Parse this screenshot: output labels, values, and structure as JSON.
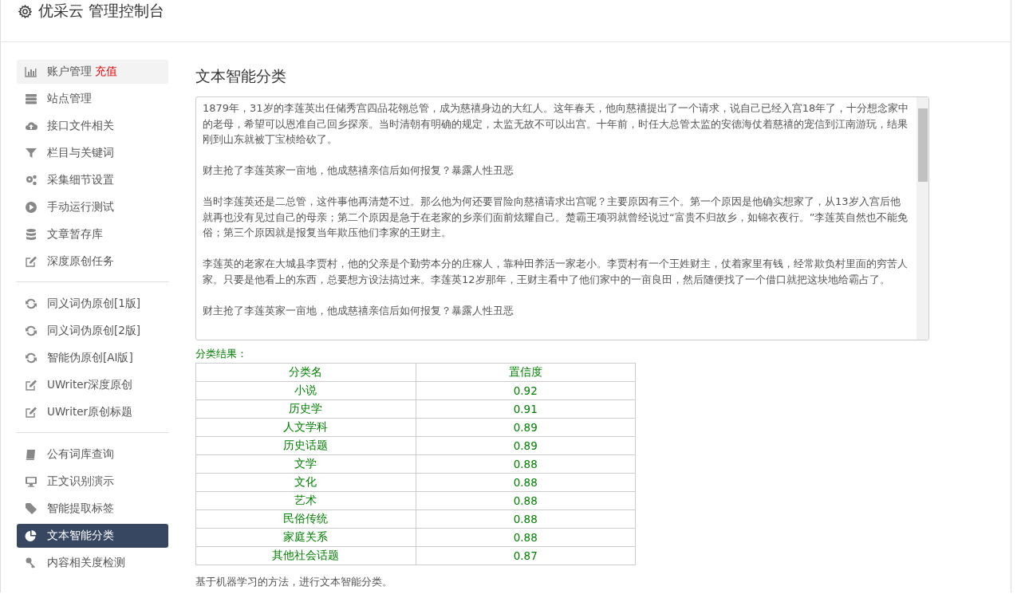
{
  "header": {
    "title": "优采云 管理控制台"
  },
  "sidebar": {
    "groups": [
      {
        "items": [
          {
            "kind": "chart",
            "label": "账户管理",
            "badge": "充值",
            "highlighted": true,
            "selected": false
          },
          {
            "kind": "server",
            "label": "站点管理",
            "highlighted": false,
            "selected": false
          },
          {
            "kind": "cloud",
            "label": "接口文件相关",
            "highlighted": false,
            "selected": false
          },
          {
            "kind": "filter",
            "label": "栏目与关键词",
            "highlighted": false,
            "selected": false
          },
          {
            "kind": "gears",
            "label": "采集细节设置",
            "highlighted": false,
            "selected": false
          },
          {
            "kind": "play",
            "label": "手动运行测试",
            "highlighted": false,
            "selected": false
          },
          {
            "kind": "database",
            "label": "文章暂存库",
            "highlighted": false,
            "selected": false
          },
          {
            "kind": "edit",
            "label": "深度原创任务",
            "highlighted": false,
            "selected": false
          }
        ]
      },
      {
        "items": [
          {
            "kind": "refresh",
            "label": "同义词伪原创[1版]",
            "highlighted": false,
            "selected": false
          },
          {
            "kind": "refresh",
            "label": "同义词伪原创[2版]",
            "highlighted": false,
            "selected": false
          },
          {
            "kind": "refresh",
            "label": "智能伪原创[AI版]",
            "highlighted": false,
            "selected": false
          },
          {
            "kind": "edit",
            "label": "UWriter深度原创",
            "highlighted": false,
            "selected": false
          },
          {
            "kind": "edit",
            "label": "UWriter原创标题",
            "highlighted": false,
            "selected": false
          }
        ]
      },
      {
        "items": [
          {
            "kind": "book",
            "label": "公有词库查询",
            "highlighted": false,
            "selected": false
          },
          {
            "kind": "monitor",
            "label": "正文识别演示",
            "highlighted": false,
            "selected": false
          },
          {
            "kind": "tag",
            "label": "智能提取标签",
            "highlighted": false,
            "selected": false
          },
          {
            "kind": "pie",
            "label": "文本智能分类",
            "highlighted": false,
            "selected": true
          },
          {
            "kind": "key",
            "label": "内容相关度检测",
            "highlighted": false,
            "selected": false
          }
        ]
      }
    ]
  },
  "main": {
    "title": "文本智能分类",
    "input_text": [
      "1879年，31岁的李莲英出任储秀宫四品花翎总管，成为慈禧身边的大红人。这年春天，他向慈禧提出了一个请求，说自己已经入宫18年了，十分想念家中的老母，希望可以恩准自己回乡探亲。当时清朝有明确的规定，太监无故不可以出宫。十年前，时任大总管太监的安德海仗着慈禧的宠信到江南游玩，结果刚到山东就被丁宝桢给砍了。",
      "财主抢了李莲英家一亩地，他成慈禧亲信后如何报复？暴露人性丑恶",
      "当时李莲英还是二总管，这件事他再清楚不过。那么他为何还要冒险向慈禧请求出宫呢？主要原因有三个。第一个原因是他确实想家了，从13岁入宫后他就再也没有见过自己的母亲；第二个原因是急于在老家的乡亲们面前炫耀自己。楚霸王项羽就曾经说过“富贵不归故乡，如锦衣夜行。”李莲英自然也不能免俗；第三个原因就是报复当年欺压他们李家的王财主。",
      "李莲英的老家在大城县李贾村，他的父亲是个勤劳本分的庄稼人，靠种田养活一家老小。李贾村有一个王姓财主，仗着家里有钱，经常欺负村里面的穷苦人家。只要是他看上的东西，总要想方设法搞过来。李莲英12岁那年，王财主看中了他们家中的一亩良田，然后随便找了一个借口就把这块地给霸占了。",
      "财主抢了李莲英家一亩地，他成慈禧亲信后如何报复？暴露人性丑恶"
    ],
    "result_label": "分类结果：",
    "table": {
      "columns": [
        "分类名",
        "置信度"
      ],
      "rows": [
        [
          "小说",
          "0.92"
        ],
        [
          "历史学",
          "0.91"
        ],
        [
          "人文学科",
          "0.89"
        ],
        [
          "历史话题",
          "0.89"
        ],
        [
          "文学",
          "0.88"
        ],
        [
          "文化",
          "0.88"
        ],
        [
          "艺术",
          "0.88"
        ],
        [
          "民俗传统",
          "0.88"
        ],
        [
          "家庭关系",
          "0.88"
        ],
        [
          "其他社会话题",
          "0.87"
        ]
      ]
    },
    "note": "基于机器学习的方法，进行文本智能分类。"
  }
}
